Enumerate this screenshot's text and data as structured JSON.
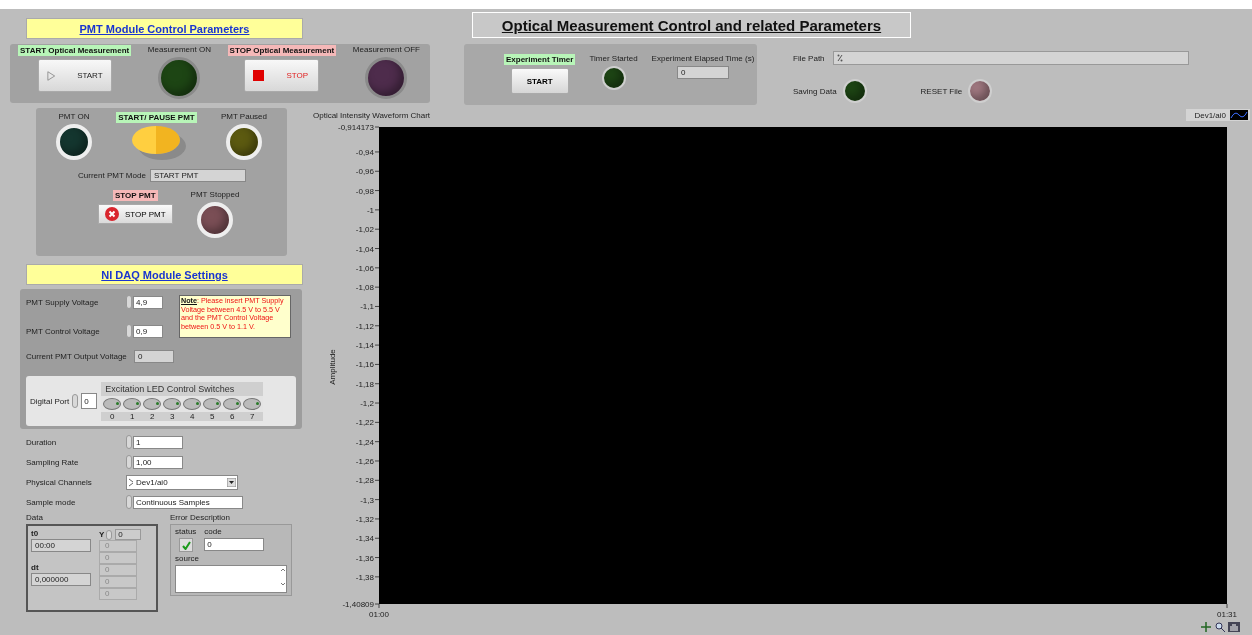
{
  "pmt_module": {
    "title": "PMT Module Control Parameters",
    "measurement": [
      {
        "kind": "start",
        "label": "START Optical Measurement",
        "button": "START"
      },
      {
        "kind": "led",
        "label": "Measurement ON",
        "color": "#1d4514"
      },
      {
        "kind": "stop",
        "label": "STOP Optical Measurement",
        "button": "STOP"
      },
      {
        "kind": "led",
        "label": "Measurement OFF",
        "color": "#4e2c4c"
      }
    ],
    "pmt_on": {
      "label": "PMT ON",
      "color": "#14362f"
    },
    "toggle": {
      "label": "START/ PAUSE PMT",
      "on": true
    },
    "paused": {
      "label": "PMT Paused",
      "color": "#5c5a10"
    },
    "mode": {
      "label": "Current PMT Mode",
      "value": "START PMT"
    },
    "stop": {
      "label": "STOP PMT",
      "button": "STOP PMT"
    },
    "stopped": {
      "label": "PMT Stopped",
      "color": "#7a4e55"
    }
  },
  "daq": {
    "title": "NI DAQ Module Settings",
    "supply": {
      "label": "PMT Supply Voltage",
      "value": "4,9"
    },
    "control": {
      "label": "PMT Control Voltage",
      "value": "0,9"
    },
    "note": "**Note**: Please insert PMT Supply Voltage between 4.5 V to 5.5 V and the PMT Control Voltage between 0.5 V to 1.1 V.",
    "output": {
      "label": "Current PMT Output Voltage",
      "value": "0"
    },
    "digital_port": {
      "label": "Digital Port",
      "value": "0"
    },
    "switches": {
      "title": "Excitation LED Control Switches",
      "items": [
        {
          "label": "0",
          "on": false
        },
        {
          "label": "1",
          "on": false
        },
        {
          "label": "2",
          "on": false
        },
        {
          "label": "3",
          "on": false
        },
        {
          "label": "4",
          "on": false
        },
        {
          "label": "5",
          "on": false
        },
        {
          "label": "6",
          "on": false
        },
        {
          "label": "7",
          "on": false
        }
      ]
    }
  },
  "settings": [
    {
      "kind": "numeric",
      "label": "Duration",
      "value": "1"
    },
    {
      "kind": "numeric",
      "label": "Sampling Rate",
      "value": "1,00"
    },
    {
      "kind": "channel",
      "label": "Physical Channels",
      "value": "Dev1/ai0"
    },
    {
      "kind": "ring",
      "label": "Sample mode",
      "value": "Continuous Samples"
    }
  ],
  "data": {
    "label": "Data",
    "t0_label": "t0",
    "t0": "00:00",
    "dt_label": "dt",
    "dt": "0,000000",
    "y_label": "Y",
    "y_index": "0",
    "y_values": [
      "0",
      "0",
      "0",
      "0",
      "0"
    ]
  },
  "error": {
    "label": "Error Description",
    "status_label": "status",
    "status": true,
    "code_label": "code",
    "code": "0",
    "source_label": "source"
  },
  "header": {
    "title": "Optical Measurement Control and related Parameters"
  },
  "timer": {
    "label": "Experiment Timer",
    "button": "START",
    "led": {
      "label": "Timer Started",
      "color": "#1d4514"
    },
    "elapsed": {
      "label": "Experiment Elapsed Time (s)",
      "value": "0"
    }
  },
  "file": {
    "label": "File Path",
    "saving": {
      "label": "Saving Data",
      "color": "#1d4514"
    },
    "reset": {
      "label": "RESET File",
      "color": "#a07880"
    }
  },
  "chart": {
    "legend": "Dev1/ai0",
    "chart_data": {
      "type": "line",
      "title": "Optical Intensity Waveform Chart",
      "ylabel": "Amplitude",
      "xlim": [
        60,
        91
      ],
      "ylim": [
        -1.40809,
        -0.914173
      ],
      "xticks": [
        {
          "value": 60,
          "label": "01:00"
        },
        {
          "value": 91,
          "label": "01:31"
        }
      ],
      "yticks": [
        {
          "value": -0.914173,
          "label": "-0,914173"
        },
        {
          "value": -0.94,
          "label": "-0,94"
        },
        {
          "value": -0.96,
          "label": "-0,96"
        },
        {
          "value": -0.98,
          "label": "-0,98"
        },
        {
          "value": -1,
          "label": "-1"
        },
        {
          "value": -1.02,
          "label": "-1,02"
        },
        {
          "value": -1.04,
          "label": "-1,04"
        },
        {
          "value": -1.06,
          "label": "-1,06"
        },
        {
          "value": -1.08,
          "label": "-1,08"
        },
        {
          "value": -1.1,
          "label": "-1,1"
        },
        {
          "value": -1.12,
          "label": "-1,12"
        },
        {
          "value": -1.14,
          "label": "-1,14"
        },
        {
          "value": -1.16,
          "label": "-1,16"
        },
        {
          "value": -1.18,
          "label": "-1,18"
        },
        {
          "value": -1.2,
          "label": "-1,2"
        },
        {
          "value": -1.22,
          "label": "-1,22"
        },
        {
          "value": -1.24,
          "label": "-1,24"
        },
        {
          "value": -1.26,
          "label": "-1,26"
        },
        {
          "value": -1.28,
          "label": "-1,28"
        },
        {
          "value": -1.3,
          "label": "-1,3"
        },
        {
          "value": -1.32,
          "label": "-1,32"
        },
        {
          "value": -1.34,
          "label": "-1,34"
        },
        {
          "value": -1.36,
          "label": "-1,36"
        },
        {
          "value": -1.38,
          "label": "-1,38"
        },
        {
          "value": -1.40809,
          "label": "-1,40809"
        }
      ]
    }
  }
}
